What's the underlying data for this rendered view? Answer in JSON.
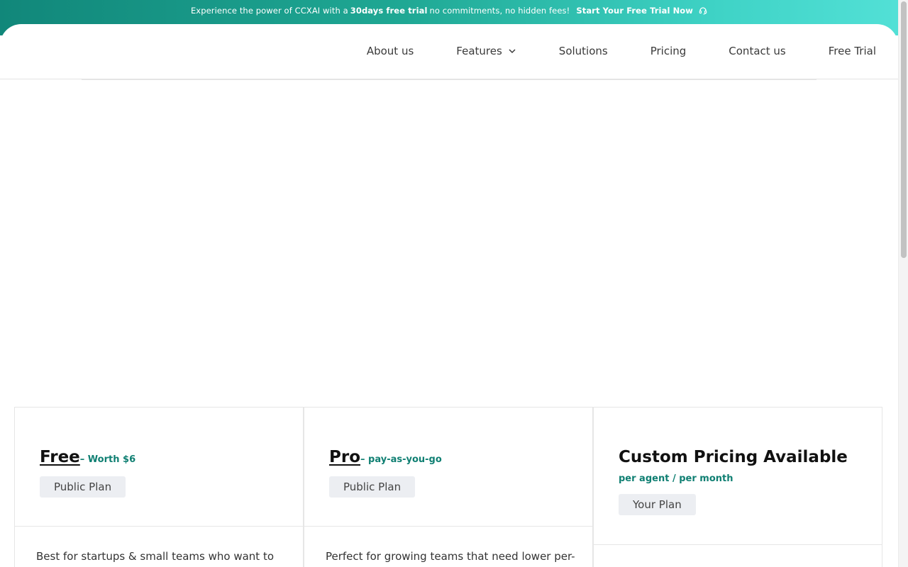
{
  "promo": {
    "text_before": "Experience the power of CCXAI with a",
    "highlight": "30days free trial",
    "text_after": "no commitments, no hidden fees!",
    "cta_label": "Start Your Free Trial Now",
    "cta_icon": "headset-icon"
  },
  "nav": {
    "items": [
      {
        "label": "About us"
      },
      {
        "label": "Features",
        "has_dropdown": true
      },
      {
        "label": "Solutions"
      },
      {
        "label": "Pricing"
      },
      {
        "label": "Contact us"
      },
      {
        "label": "Free Trial"
      }
    ]
  },
  "plans": [
    {
      "name": "Free",
      "suffix": "– Worth $6",
      "badge": "Public Plan",
      "description": "Best for startups & small teams who want to"
    },
    {
      "name": "Pro",
      "suffix": "– pay-as-you-go",
      "badge": "Public Plan",
      "description": "Perfect for growing teams that need lower per-"
    },
    {
      "name": "Custom Pricing Available",
      "note": "per agent / per month",
      "badge": "Your Plan"
    }
  ],
  "colors": {
    "brand_teal": "#0f7f72",
    "banner_start": "#11877a",
    "banner_end": "#52e0d6",
    "badge_bg": "#eceef2"
  }
}
